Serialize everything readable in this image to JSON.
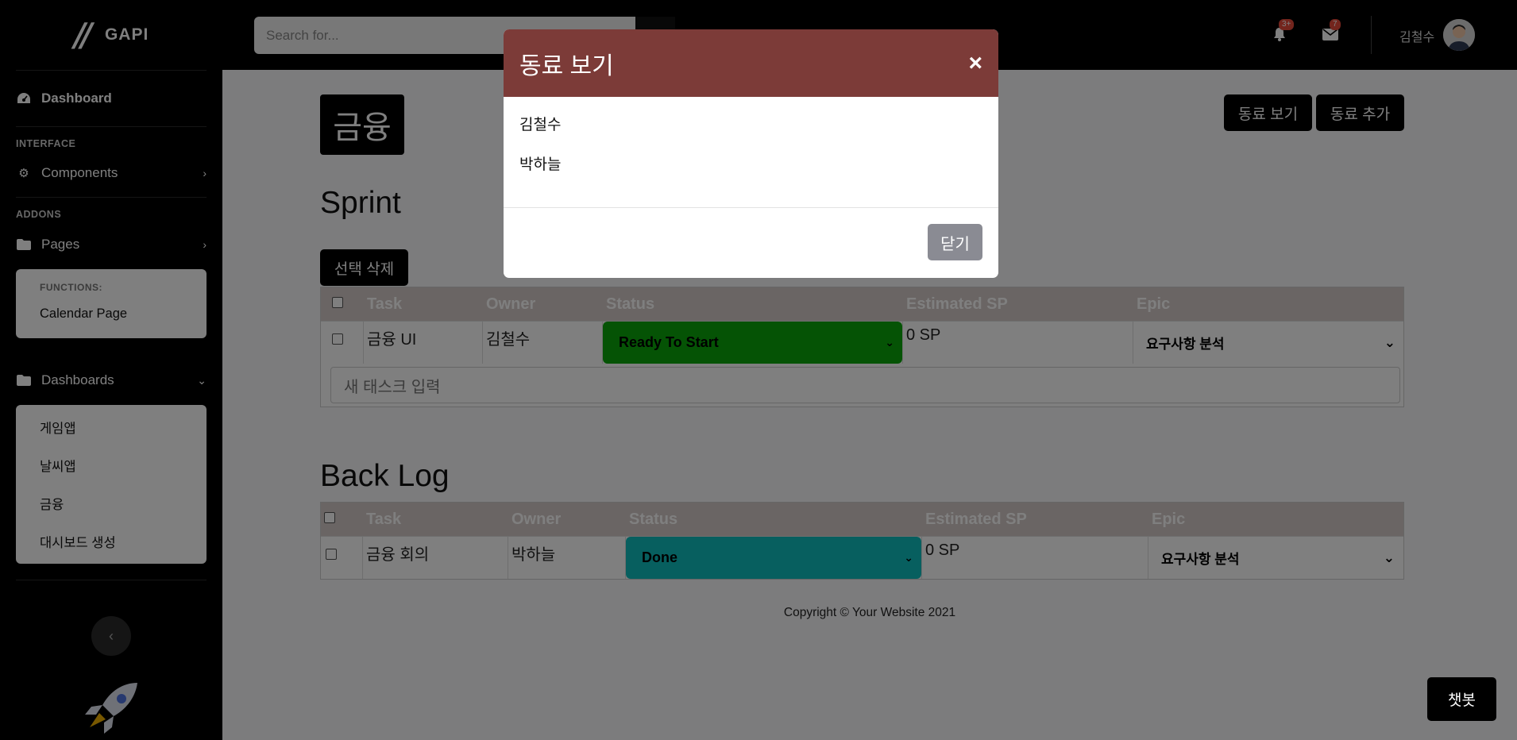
{
  "brand": {
    "name": "GAPI",
    "logo_text": "//"
  },
  "sidebar": {
    "dashboard_label": "Dashboard",
    "interface_heading": "INTERFACE",
    "components_label": "Components",
    "addons_heading": "ADDONS",
    "pages_label": "Pages",
    "pages_submenu": {
      "heading": "FUNCTIONS:",
      "items": [
        "Calendar Page"
      ]
    },
    "dashboards_label": "Dashboards",
    "dashboards_submenu": [
      "게임앱",
      "날씨앱",
      "금융",
      "대시보드 생성"
    ]
  },
  "topbar": {
    "search_placeholder": "Search for...",
    "alerts_badge": "3+",
    "messages_badge": "7",
    "user_name": "김철수"
  },
  "page": {
    "badge": "금융",
    "view_colleagues_button": "동료 보기",
    "add_colleague_button": "동료 추가",
    "sprint_title": "Sprint",
    "delete_selected_button": "선택 삭제",
    "backlog_title": "Back Log",
    "new_task_placeholder": "새 태스크 입력",
    "copyright": "Copyright © Your Website 2021",
    "chatbot_button": "챗봇"
  },
  "table_headers": [
    "Task",
    "Owner",
    "Status",
    "Estimated SP",
    "Epic"
  ],
  "sprint_rows": [
    {
      "task": "금융 UI",
      "owner": "김철수",
      "status": "Ready To Start",
      "status_color": "#0aa60a",
      "sp": "0 SP",
      "epic": "요구사항 분석"
    }
  ],
  "backlog_rows": [
    {
      "task": "금융 회의",
      "owner": "박하늘",
      "status": "Done",
      "status_color": "#0fbfbf",
      "sp": "0 SP",
      "epic": "요구사항 분석"
    }
  ],
  "modal": {
    "title": "동료 보기",
    "close_symbol": "×",
    "members": [
      "김철수",
      "박하늘"
    ],
    "close_button": "닫기",
    "header_color": "#7c3b38"
  },
  "icons": {
    "dashboard": "tachometer-icon",
    "components": "gear-icon",
    "pages": "folder-icon",
    "dashboards": "folder-icon",
    "alerts": "bell-icon",
    "messages": "envelope-icon",
    "search": "search-icon",
    "collapse": "chevron-left-icon",
    "rocket": "rocket-icon"
  }
}
